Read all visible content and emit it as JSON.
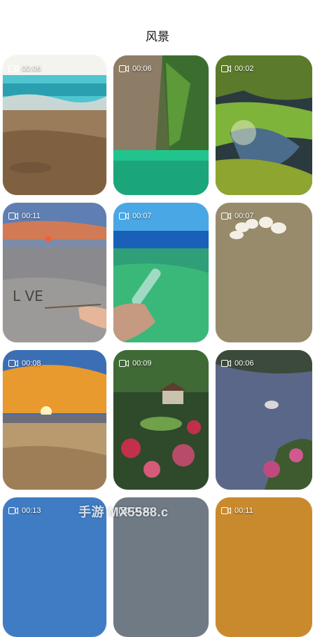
{
  "header": {
    "title": "风景"
  },
  "videos": [
    {
      "duration": "00:06"
    },
    {
      "duration": "00:06"
    },
    {
      "duration": "00:02"
    },
    {
      "duration": "00:11"
    },
    {
      "duration": "00:07"
    },
    {
      "duration": "00:07"
    },
    {
      "duration": "00:08"
    },
    {
      "duration": "00:09"
    },
    {
      "duration": "00:06"
    },
    {
      "duration": "00:13"
    },
    {
      "duration": "00:10"
    },
    {
      "duration": "00:11"
    }
  ],
  "watermark": "手游 MX5588.c",
  "icons": {
    "duration_icon": "video-camera-icon"
  }
}
